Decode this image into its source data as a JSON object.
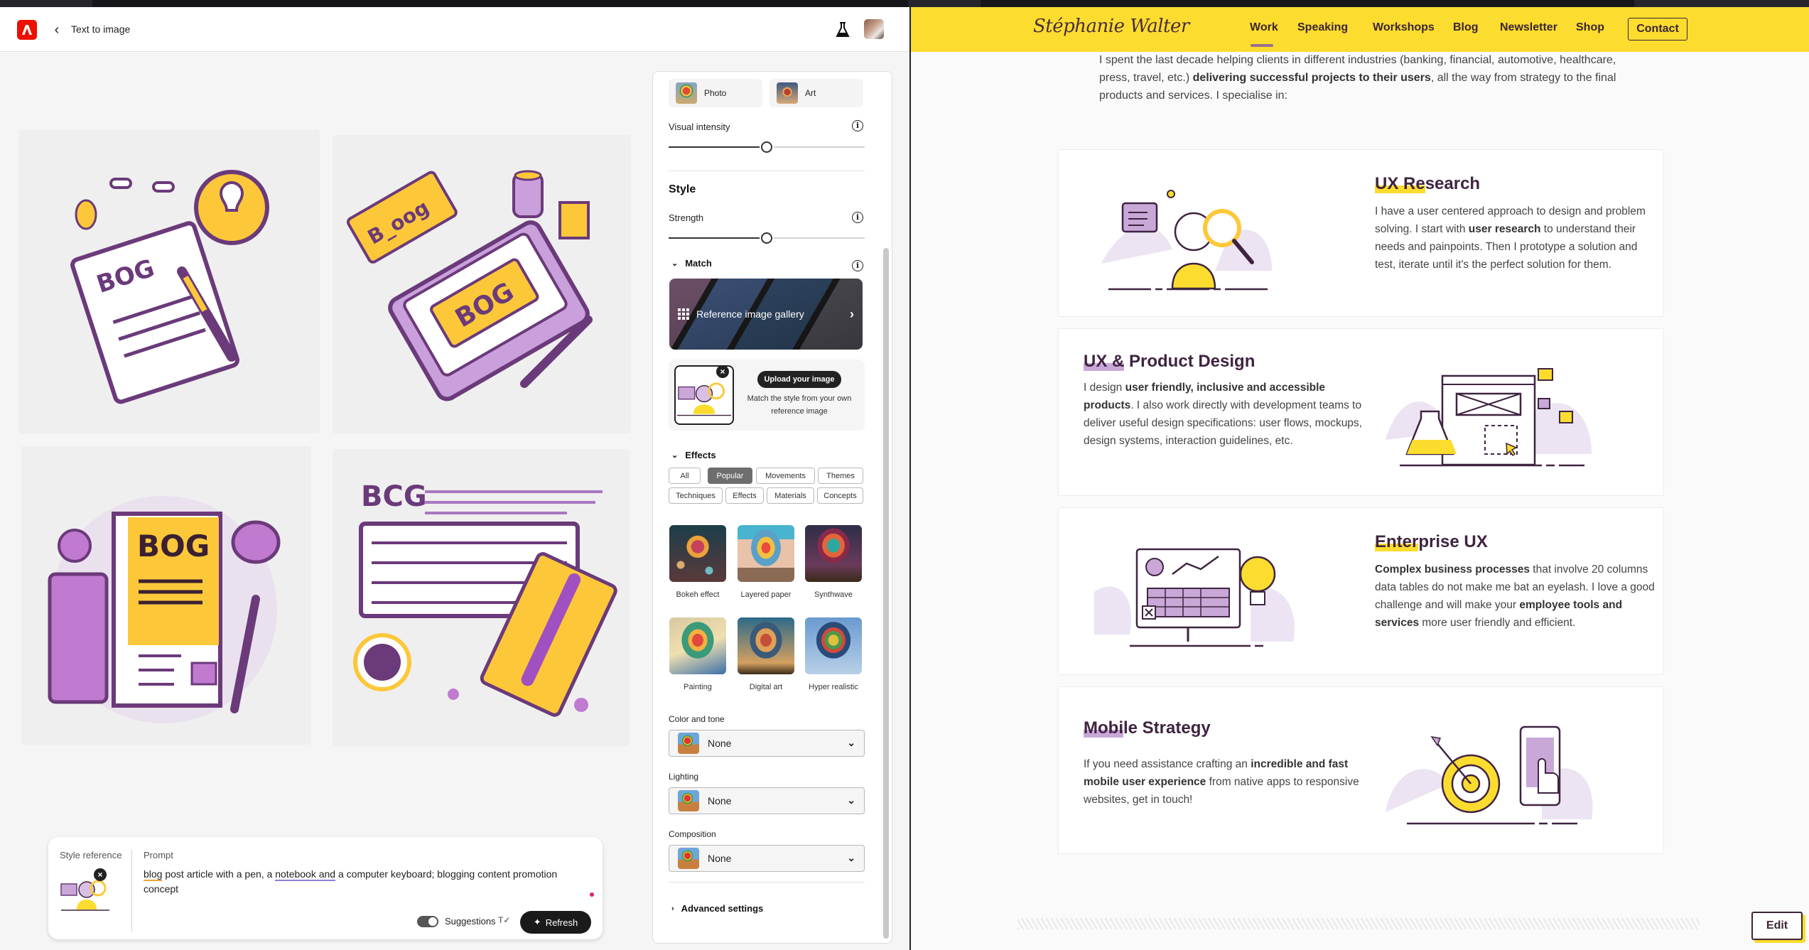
{
  "firefly": {
    "header": {
      "title": "Text to image",
      "back_icon": "chevron-left-icon",
      "logo_icon": "adobe-logo",
      "labs_icon": "flask-icon"
    },
    "generated_images": [
      {
        "alt": "Notebook with BOG text, pencil and lightbulb speech bubble"
      },
      {
        "alt": "Tablet with BOG and B_oog labels, cup and pen"
      },
      {
        "alt": "Yellow BOG book with mug, pen and purple block"
      },
      {
        "alt": "BCG text above keyboard with notebook, pen and coffee cup"
      }
    ],
    "prompt_bar": {
      "style_reference_label": "Style reference",
      "prompt_label": "Prompt",
      "prompt_parts": [
        {
          "text": "blog",
          "mark": "spelling"
        },
        {
          "text": " post article with a pen, a ",
          "mark": ""
        },
        {
          "text": "notebook and",
          "mark": "grammar"
        },
        {
          "text": " a computer keyboard; blogging content promotion concept",
          "mark": ""
        }
      ],
      "suggestions_label": "Suggestions",
      "suggestions_on": true,
      "refresh_label": "Refresh"
    },
    "panel": {
      "content_types": [
        {
          "label": "Photo"
        },
        {
          "label": "Art"
        }
      ],
      "visual_intensity": {
        "label": "Visual intensity",
        "value_fraction": 0.5
      },
      "style_heading": "Style",
      "strength": {
        "label": "Strength",
        "value_fraction": 0.5
      },
      "match": {
        "label": "Match",
        "gallery_label": "Reference image gallery",
        "upload_button": "Upload your image",
        "upload_desc": "Match the style from your own reference image"
      },
      "effects": {
        "label": "Effects",
        "filters": [
          "All",
          "Popular",
          "Movements",
          "Themes",
          "Techniques",
          "Effects",
          "Materials",
          "Concepts"
        ],
        "active_filter": "Popular",
        "items": [
          "Bokeh effect",
          "Layered paper",
          "Synthwave",
          "Painting",
          "Digital art",
          "Hyper realistic"
        ]
      },
      "color_and_tone": {
        "label": "Color and tone",
        "value": "None"
      },
      "lighting": {
        "label": "Lighting",
        "value": "None"
      },
      "composition": {
        "label": "Composition",
        "value": "None"
      },
      "advanced_settings": "Advanced settings"
    }
  },
  "website": {
    "logo": "Stéphanie Walter",
    "nav": [
      "Work",
      "Speaking",
      "Workshops",
      "Blog",
      "Newsletter",
      "Shop"
    ],
    "active_nav": "Work",
    "contact_label": "Contact",
    "intro": {
      "before": "I spent the last decade helping clients in different industries (banking, financial, automotive, healthcare, press, travel, etc.) ",
      "bold": "delivering successful projects to their users",
      "after": ", all the way from strategy to the final products and services. I specialise in:"
    },
    "services": [
      {
        "title_hl": "UX Re",
        "title_rest": "search",
        "parts": [
          {
            "t": "I have a user centered approach to design and problem solving. I start with ",
            "b": false
          },
          {
            "t": "user research",
            "b": true
          },
          {
            "t": " to understand their needs and painpoints. Then I prototype a solution and test, iterate until it's the perfect solution for them.",
            "b": false
          }
        ]
      },
      {
        "title_hl": "UX &",
        "title_rest": " Product Design",
        "parts": [
          {
            "t": "I design ",
            "b": false
          },
          {
            "t": "user friendly, inclusive and accessible products",
            "b": true
          },
          {
            "t": ". I also work directly with development teams to deliver useful design specifications: user flows, mockups, design systems, interaction guidelines, etc.",
            "b": false
          }
        ]
      },
      {
        "title_hl": "Enter",
        "title_rest": "prise UX",
        "parts": [
          {
            "t": "Complex business processes",
            "b": true
          },
          {
            "t": " that involve 20 columns data tables do not make me bat an eyelash. I love a good challenge and will make your ",
            "b": false
          },
          {
            "t": "employee tools and services",
            "b": true
          },
          {
            "t": " more user friendly and efficient.",
            "b": false
          }
        ]
      },
      {
        "title_hl": "Mobi",
        "title_rest": "le Strategy",
        "parts": [
          {
            "t": "If you need assistance crafting an ",
            "b": false
          },
          {
            "t": "incredible and fast mobile user experience",
            "b": true
          },
          {
            "t": " from native apps to responsive websites, get in touch!",
            "b": false
          }
        ]
      }
    ],
    "edit_label": "Edit",
    "colors": {
      "brand_yellow": "#fcdc2e",
      "brand_purple": "#3f2440"
    }
  }
}
